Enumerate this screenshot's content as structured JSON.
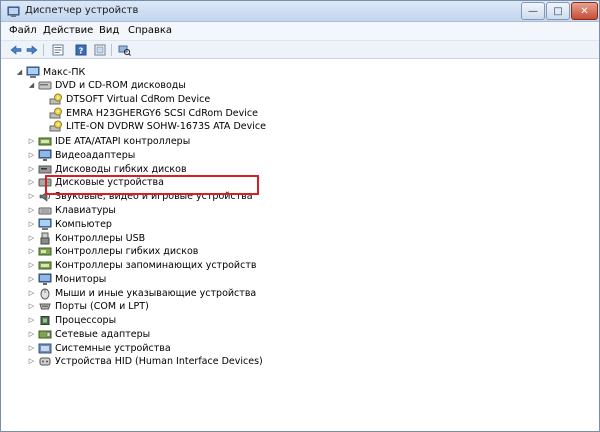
{
  "window": {
    "title": "Диспетчер устройств",
    "buttons": {
      "minimize": "—",
      "maximize": "□",
      "close": "✕"
    }
  },
  "menu": [
    "Файл",
    "Действие",
    "Вид",
    "Справка"
  ],
  "toolbar": [
    "back-arrow-icon",
    "forward-arrow-icon",
    "properties-icon",
    "help-icon",
    "refresh-icon",
    "scan-hardware-icon"
  ],
  "tree": {
    "root": "Макс-ПК",
    "dvd_group": "DVD и CD-ROM дисководы",
    "dvd_children": [
      "DTSOFT Virtual CdRom Device",
      "EMRA H23GHERGY6 SCSI CdRom Device",
      "LITE-ON DVDRW SOHW-1673S ATA Device"
    ],
    "categories": [
      "IDE ATA/ATAPI контроллеры",
      "Видеоадаптеры",
      "Дисководы гибких дисков",
      "Дисковые устройства",
      "Звуковые, видео и игровые устройства",
      "Клавиатуры",
      "Компьютер",
      "Контроллеры USB",
      "Контроллеры гибких дисков",
      "Контроллеры запоминающих устройств",
      "Мониторы",
      "Мыши и иные указывающие устройства",
      "Порты (COM и LPT)",
      "Процессоры",
      "Сетевые адаптеры",
      "Системные устройства",
      "Устройства HID (Human Interface Devices)"
    ],
    "highlight_color": "#d81f26"
  }
}
